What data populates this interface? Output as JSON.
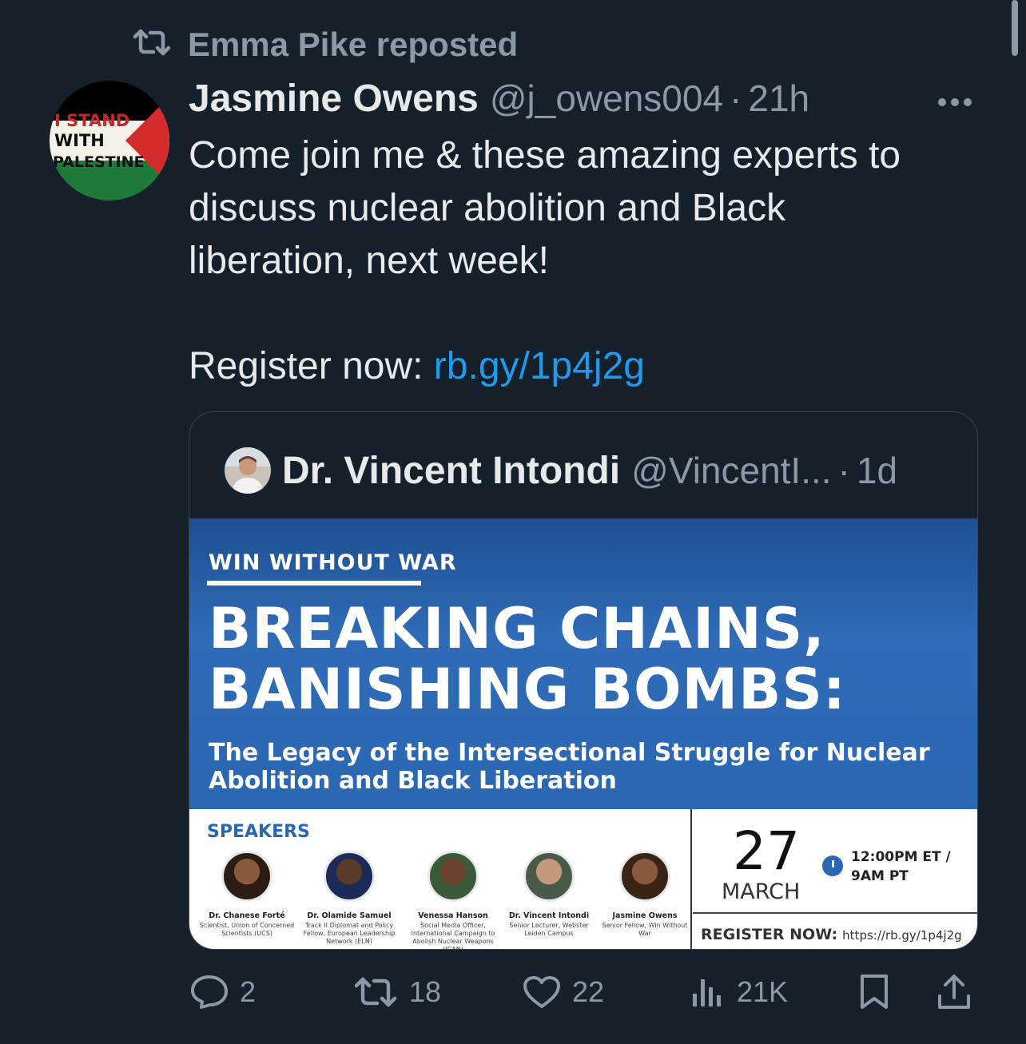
{
  "repost": {
    "label": "Emma Pike reposted",
    "icon": "repost-icon"
  },
  "tweet": {
    "author_name": "Jasmine Owens",
    "handle": "@j_owens004",
    "separator": "·",
    "time": "21h",
    "more_icon": "more-icon",
    "avatar_text": [
      "I STAND",
      "WITH",
      "PALESTINE"
    ],
    "text_lines": [
      "Come join me & these amazing experts to",
      "discuss nuclear abolition and Black",
      "liberation, next week!"
    ],
    "register_prefix": "Register now: ",
    "register_link": "rb.gy/1p4j2g"
  },
  "quote": {
    "author_name": "Dr. Vincent Intondi",
    "handle": "@VincentI...",
    "separator": "·",
    "time": "1d",
    "flyer": {
      "org": "WIN WITHOUT WAR",
      "headline_1": "BREAKING CHAINS,",
      "headline_2": "BANISHING BOMBS:",
      "subhead_1": "The Legacy of the Intersectional Struggle for Nuclear",
      "subhead_2": "Abolition and Black Liberation",
      "speakers_title": "SPEAKERS",
      "speakers": [
        {
          "name": "Dr. Chanese Forté",
          "role": "Scientist, Union of Concerned Scientists (UCS)"
        },
        {
          "name": "Dr. Olamide Samuel",
          "role": "Track II Diplomat and Policy Fellow, European Leadership Network (ELN)"
        },
        {
          "name": "Venessa Hanson",
          "role": "Social Media Officer, International Campaign to Abolish Nuclear Weapons (ICAN)"
        },
        {
          "name": "Dr. Vincent Intondi",
          "role": "Senior Lecturer, Webster Leiden Campus"
        },
        {
          "name": "Jasmine Owens",
          "role": "Senior Fellow, Win Without War"
        }
      ],
      "date_day": "27",
      "date_month": "MARCH",
      "time_1": "12:00PM ET /",
      "time_2": "9AM PT",
      "register_label": "REGISTER NOW:",
      "register_url": "https://rb.gy/1p4j2g"
    }
  },
  "actions": {
    "reply_count": "2",
    "repost_count": "18",
    "like_count": "22",
    "views_count": "21K"
  },
  "colors": {
    "background": "#15202b",
    "text": "#e7e9ea",
    "muted": "#8b98a5",
    "link": "#1d9bf0",
    "flyer_blue": "#2a67b2"
  }
}
